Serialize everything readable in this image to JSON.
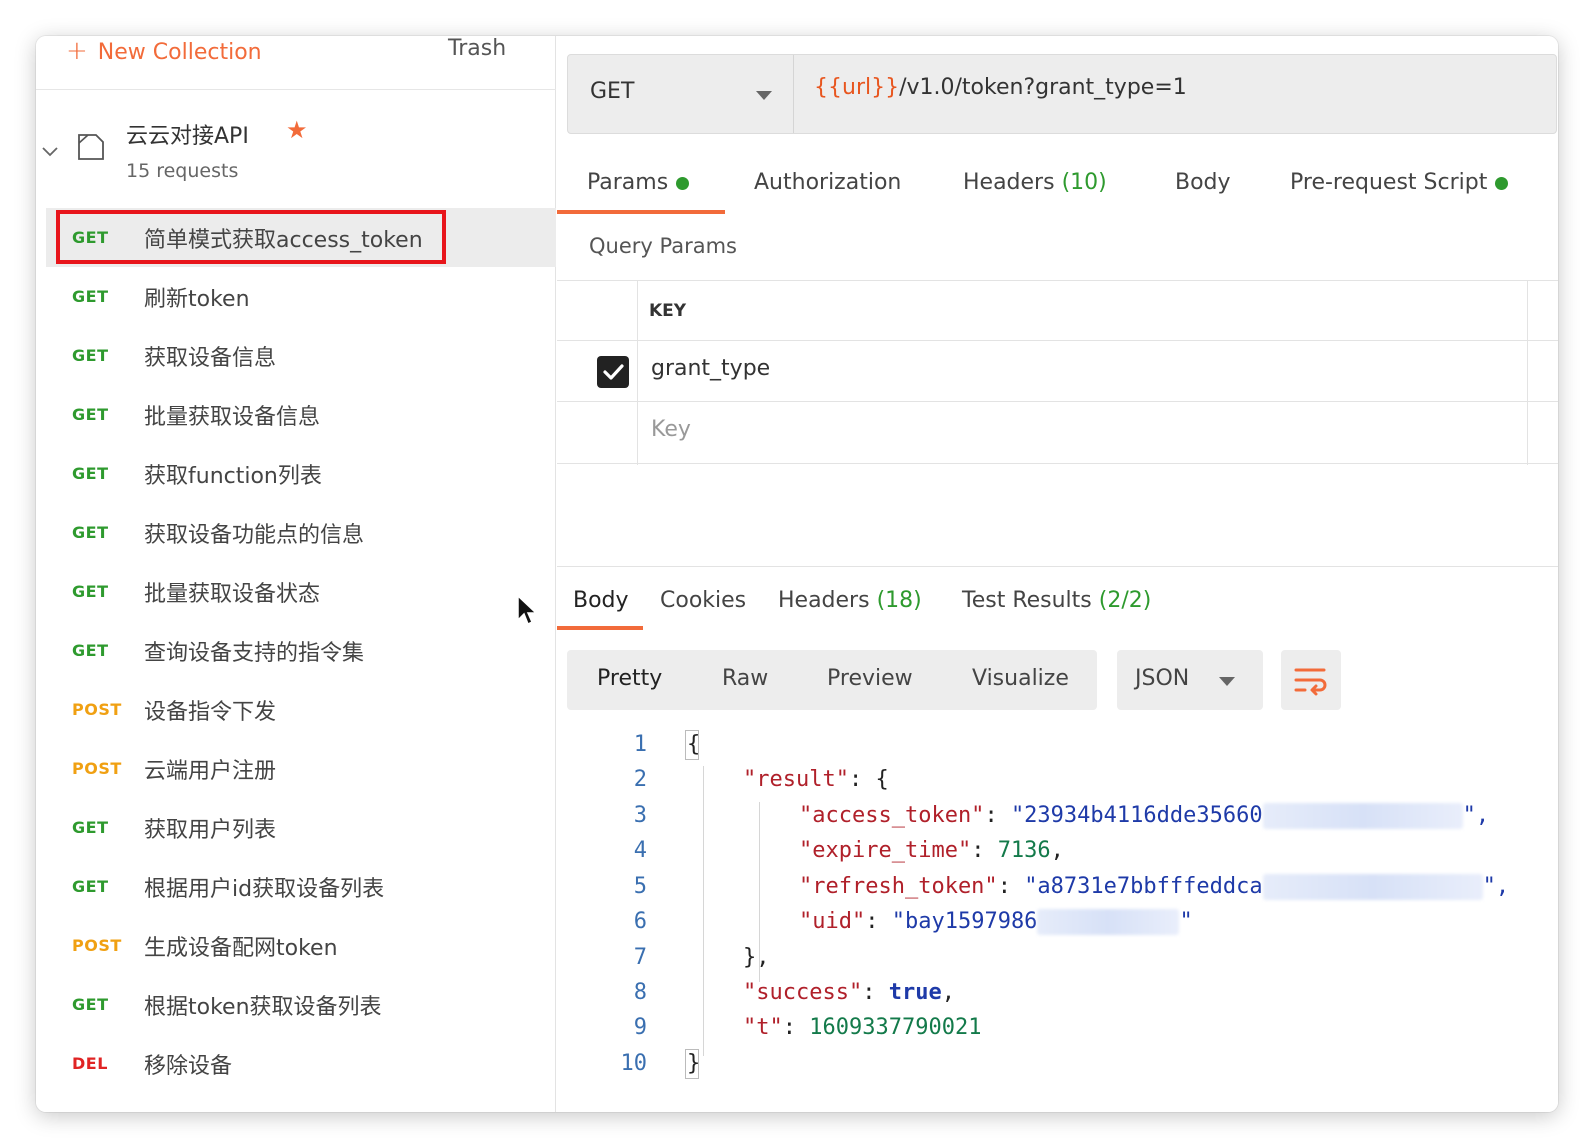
{
  "sidebar": {
    "new_collection": "New Collection",
    "trash": "Trash",
    "collection": {
      "name": "云云对接API",
      "count": "15 requests"
    },
    "requests": [
      {
        "method": "GET",
        "name": "简单模式获取access_token",
        "selected": true
      },
      {
        "method": "GET",
        "name": "刷新token"
      },
      {
        "method": "GET",
        "name": "获取设备信息"
      },
      {
        "method": "GET",
        "name": "批量获取设备信息"
      },
      {
        "method": "GET",
        "name": "获取function列表"
      },
      {
        "method": "GET",
        "name": "获取设备功能点的信息"
      },
      {
        "method": "GET",
        "name": "批量获取设备状态"
      },
      {
        "method": "GET",
        "name": "查询设备支持的指令集"
      },
      {
        "method": "POST",
        "name": "设备指令下发"
      },
      {
        "method": "POST",
        "name": "云端用户注册"
      },
      {
        "method": "GET",
        "name": "获取用户列表"
      },
      {
        "method": "GET",
        "name": "根据用户id获取设备列表"
      },
      {
        "method": "POST",
        "name": "生成设备配网token"
      },
      {
        "method": "GET",
        "name": "根据token获取设备列表"
      },
      {
        "method": "DEL",
        "name": "移除设备"
      }
    ]
  },
  "request": {
    "method": "GET",
    "url_var": "{{url}}",
    "url_path": "/v1.0/token?grant_type=1",
    "tabs": {
      "params": "Params",
      "authorization": "Authorization",
      "headers": "Headers",
      "headers_count": "(10)",
      "body": "Body",
      "prerequest": "Pre-request Script"
    },
    "query_params_label": "Query Params",
    "table": {
      "key_header": "KEY",
      "row_key": "grant_type",
      "placeholder": "Key"
    }
  },
  "response": {
    "tabs": {
      "body": "Body",
      "cookies": "Cookies",
      "headers": "Headers",
      "headers_count": "(18)",
      "tests": "Test Results",
      "tests_count": "(2/2)"
    },
    "views": [
      "Pretty",
      "Raw",
      "Preview",
      "Visualize"
    ],
    "format": "JSON",
    "lines": {
      "l1": "{",
      "l2_key": "\"result\"",
      "l2_rest": ": {",
      "l3_key": "\"access_token\"",
      "l3_val": "\"23934b4116dde35660",
      "l3_end": "\",",
      "l4_key": "\"expire_time\"",
      "l4_val": "7136",
      "l5_key": "\"refresh_token\"",
      "l5_val": "\"a8731e7bbfffeddca",
      "l5_end": "\",",
      "l6_key": "\"uid\"",
      "l6_val": "\"bay1597986",
      "l6_end": "\"",
      "l7": "},",
      "l8_key": "\"success\"",
      "l8_val": "true",
      "l9_key": "\"t\"",
      "l9_val": "1609337790021",
      "l10": "}"
    },
    "line_numbers": [
      "1",
      "2",
      "3",
      "4",
      "5",
      "6",
      "7",
      "8",
      "9",
      "10"
    ]
  },
  "colors": {
    "accent": "#f26b3a",
    "get": "#2e9a2e",
    "post": "#f0a012",
    "del": "#e02424",
    "highlight_box": "#e8151b"
  }
}
